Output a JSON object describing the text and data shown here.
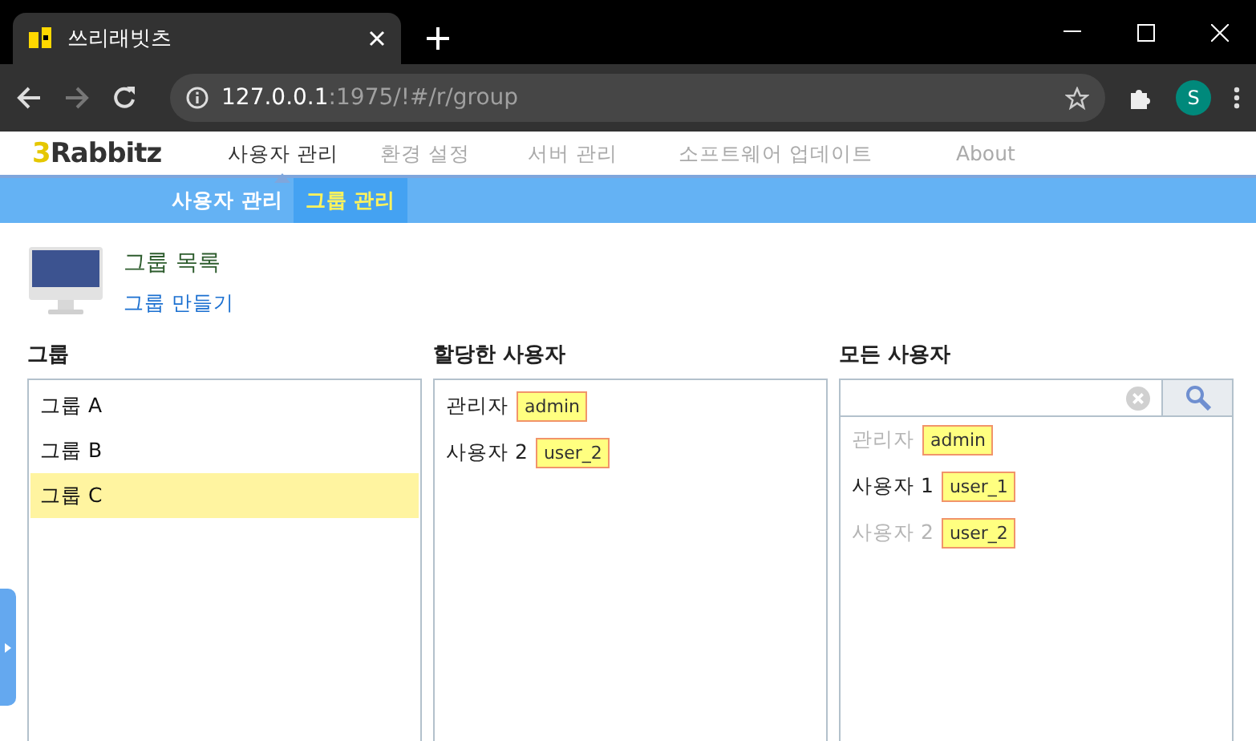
{
  "browser": {
    "tab_title": "쓰리래빗츠",
    "url_host": "127.0.0.1",
    "url_rest": ":1975/!#/r/group",
    "profile": "S"
  },
  "app": {
    "logo_lead": "3",
    "logo_rest": "Rabbitz",
    "nav": [
      {
        "label": "사용자 관리",
        "selected": true
      },
      {
        "label": "환경 설정",
        "selected": false
      },
      {
        "label": "서버 관리",
        "selected": false
      },
      {
        "label": "소프트웨어 업데이트",
        "selected": false
      },
      {
        "label": "About",
        "selected": false
      }
    ],
    "subnav": [
      {
        "label": "사용자 관리",
        "selected": false
      },
      {
        "label": "그룹 관리",
        "selected": true
      }
    ]
  },
  "page": {
    "title": "그룹 목록",
    "create_link": "그룹 만들기"
  },
  "groups": {
    "heading": "그룹",
    "items": [
      {
        "label": "그룹 A",
        "selected": false
      },
      {
        "label": "그룹 B",
        "selected": false
      },
      {
        "label": "그룹 C",
        "selected": true
      }
    ]
  },
  "assigned_users": {
    "heading": "할당한 사용자",
    "items": [
      {
        "name": "관리자",
        "id": "admin"
      },
      {
        "name": "사용자 2",
        "id": "user_2"
      }
    ]
  },
  "all_users": {
    "heading": "모든 사용자",
    "items": [
      {
        "name": "관리자",
        "id": "admin",
        "disabled": true
      },
      {
        "name": "사용자 1",
        "id": "user_1",
        "disabled": false
      },
      {
        "name": "사용자 2",
        "id": "user_2",
        "disabled": true
      }
    ]
  }
}
